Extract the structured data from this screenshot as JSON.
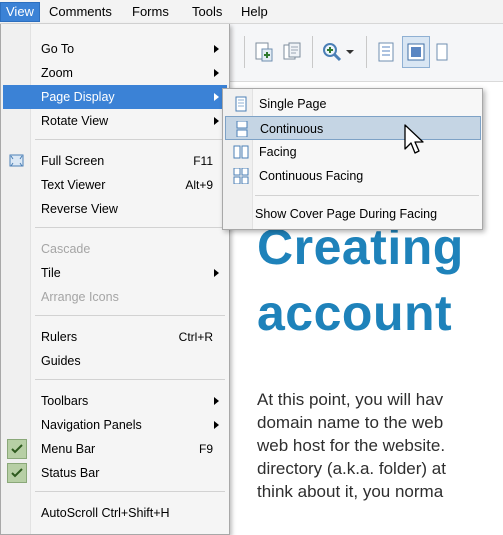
{
  "menubar": {
    "items": [
      "View",
      "Comments",
      "Forms",
      "Tools",
      "Help"
    ]
  },
  "view_menu": {
    "items": [
      {
        "label": "Go To",
        "submenu": true
      },
      {
        "label": "Zoom",
        "submenu": true
      },
      {
        "label": "Page Display",
        "submenu": true,
        "highlighted": true
      },
      {
        "label": "Rotate View",
        "submenu": true
      },
      {
        "label": "Full Screen",
        "shortcut": "F11"
      },
      {
        "label": "Text Viewer",
        "shortcut": "Alt+9"
      },
      {
        "label": "Reverse View"
      },
      {
        "label": "Cascade",
        "disabled": true
      },
      {
        "label": "Tile",
        "submenu": true
      },
      {
        "label": "Arrange Icons",
        "disabled": true
      },
      {
        "label": "Rulers",
        "shortcut": "Ctrl+R"
      },
      {
        "label": "Guides"
      },
      {
        "label": "Toolbars",
        "submenu": true
      },
      {
        "label": "Navigation Panels",
        "submenu": true
      },
      {
        "label": "Menu Bar",
        "shortcut": "F9",
        "checked": true
      },
      {
        "label": "Status Bar",
        "checked": true
      },
      {
        "label": "AutoScroll Ctrl+Shift+H"
      }
    ]
  },
  "page_display_submenu": {
    "items": [
      {
        "label": "Single Page"
      },
      {
        "label": "Continuous",
        "highlighted": true
      },
      {
        "label": "Facing"
      },
      {
        "label": "Continuous Facing"
      },
      {
        "label": "Show Cover Page During Facing"
      }
    ]
  },
  "document": {
    "heading_line1": "Creating",
    "heading_line2": "account",
    "body_lines": [
      "At this point, you will hav",
      "domain name to the web",
      "web host for the website.",
      "directory (a.k.a. folder) at",
      "think about it, you norma"
    ]
  },
  "colors": {
    "menu_highlight": "#3b82d6",
    "submenu_highlight": "#c5d5e4",
    "heading": "#1e82ba",
    "check_bg": "#b7cfa5"
  },
  "icons": {
    "full_screen": "full-screen-icon",
    "single_page": "single-page-icon",
    "continuous": "continuous-icon",
    "facing": "facing-icon",
    "continuous_facing": "continuous-facing-icon",
    "checkmark": "checkmark-icon",
    "cursor": "mouse-pointer-icon"
  }
}
